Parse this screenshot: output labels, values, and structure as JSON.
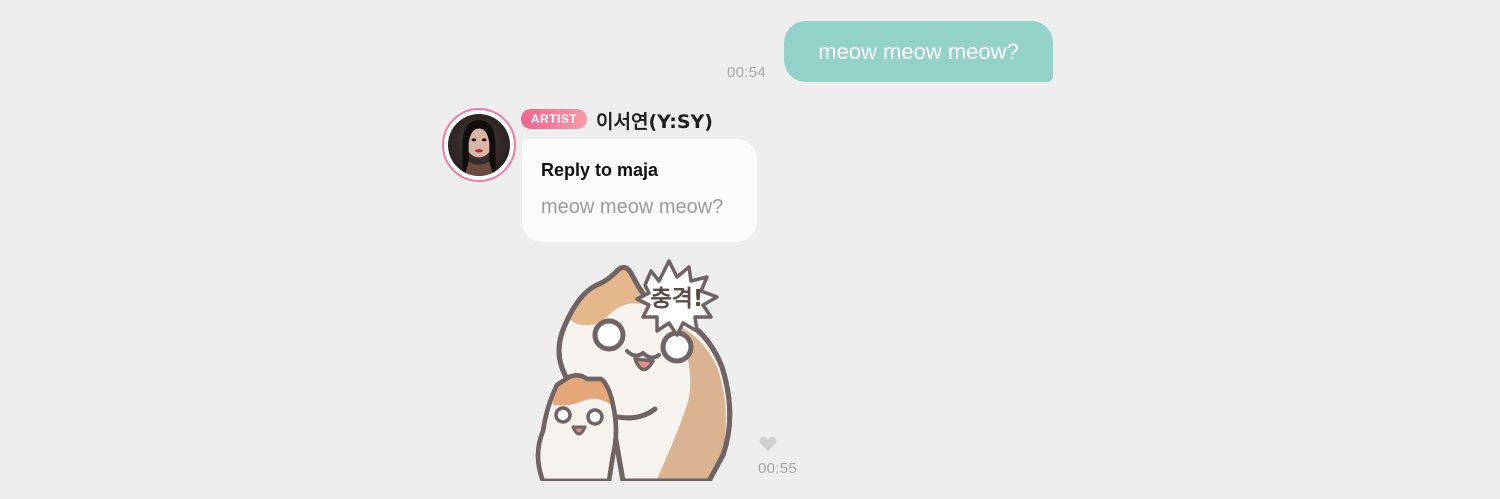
{
  "outgoing_message": {
    "text": "meow meow meow?",
    "time": "00:54"
  },
  "incoming_message": {
    "sender": {
      "badge": "ARTIST",
      "name": "이서연(Y:SY)",
      "avatar_icon": "profile-photo"
    },
    "reply": {
      "title": "Reply to maja",
      "quoted_text": "meow meow meow?"
    },
    "sticker": {
      "caption": "충격!",
      "icon": "shocked-cats-sticker"
    },
    "reaction_icon": "heart-icon",
    "time": "00:55"
  },
  "colors": {
    "background": "#eeeeee",
    "outgoing_bubble": "#93d2c8",
    "badge_pink": "#f0648f",
    "avatar_ring": "#f07aa3",
    "timestamp": "#a7a7a7"
  }
}
